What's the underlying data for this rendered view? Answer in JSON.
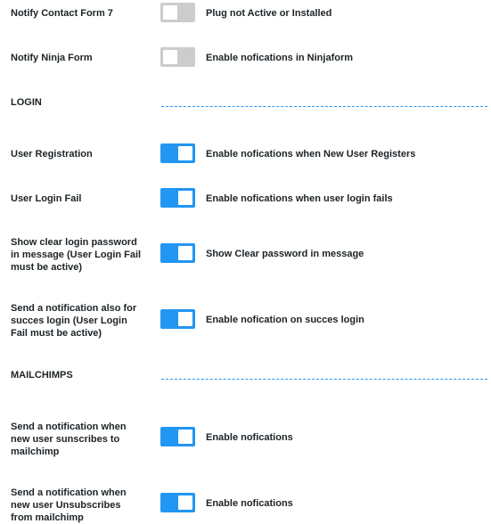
{
  "rows": [
    {
      "label": "Notify Contact Form 7",
      "desc": "Plug not Active or Installed",
      "state": "off"
    },
    {
      "label": "Notify Ninja Form",
      "desc": "Enable nofications in Ninjaform",
      "state": "off"
    },
    {
      "label": "User Registration",
      "desc": "Enable nofications when New User Registers",
      "state": "on"
    },
    {
      "label": "User Login Fail",
      "desc": "Enable nofications when user login fails",
      "state": "on"
    },
    {
      "label": "Show clear login password in message (User Login Fail must be active)",
      "desc": "Show Clear password in message",
      "state": "on"
    },
    {
      "label": "Send a notification also for succes login (User Login Fail must be active)",
      "desc": "Enable nofication on succes login",
      "state": "on"
    },
    {
      "label": "Send a notification when new user sunscribes to mailchimp",
      "desc": "Enable nofications",
      "state": "on"
    },
    {
      "label": "Send a notification when new user Unsubscribes from mailchimp",
      "desc": "Enable nofications",
      "state": "on"
    }
  ],
  "sections": {
    "login": "LOGIN",
    "mailchimps": "MAILCHIMPS"
  },
  "colors": {
    "toggle_on": "#2196f3",
    "toggle_off": "#cccccc",
    "divider": "#2196f3"
  }
}
